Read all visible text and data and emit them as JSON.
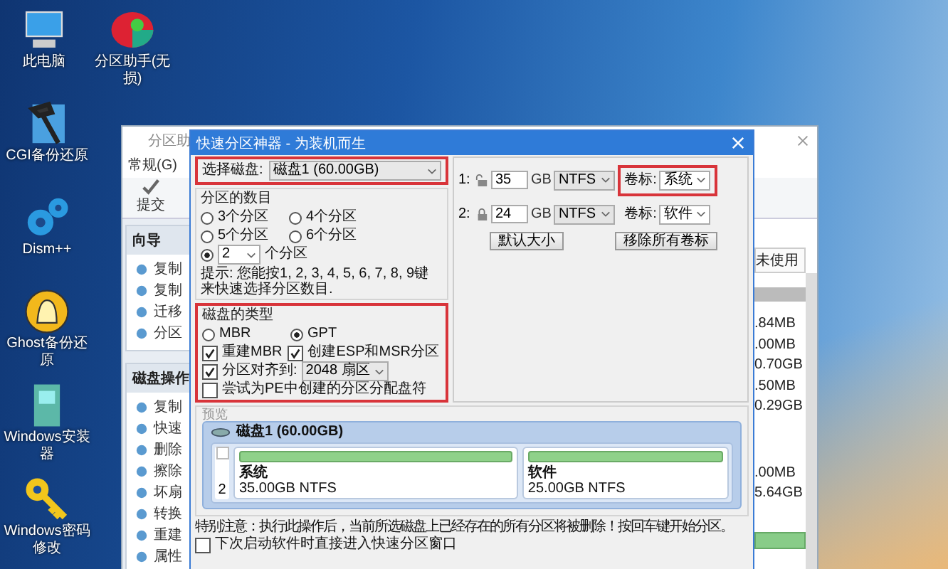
{
  "desktop_icons": [
    {
      "label": "此电脑",
      "kind": "pc"
    },
    {
      "label": "分区助手(无损)",
      "kind": "partition"
    },
    {
      "label": "CGI备份还原",
      "kind": "hammer"
    },
    {
      "label": "Dism++",
      "kind": "gears"
    },
    {
      "label": "Ghost备份还原",
      "kind": "ghost"
    },
    {
      "label": "Windows安装器",
      "kind": "installer"
    },
    {
      "label": "Windows密码修改",
      "kind": "key"
    }
  ],
  "app_window": {
    "title": "分区助",
    "menu": [
      "常规(G)"
    ],
    "toolbar": [
      "提交"
    ],
    "sections": [
      {
        "title": "向导",
        "items": [
          "复制",
          "复制",
          "迁移",
          "分区"
        ]
      },
      {
        "title": "磁盘操作",
        "items": [
          "复制",
          "快速",
          "删除",
          "擦除",
          "坏扇",
          "转换",
          "重建",
          "属性"
        ]
      }
    ],
    "column_header": "未使用",
    "values": [
      ".84MB",
      ".00MB",
      "0.70GB",
      ".50MB",
      "0.29GB"
    ],
    "values_2": [
      ".00MB",
      "5.64GB"
    ]
  },
  "dialog": {
    "title": "快速分区神器 - 为装机而生",
    "disk_select": {
      "label": "选择磁盘:",
      "value": "磁盘1 (60.00GB)",
      "highlighted": true
    },
    "count_group": {
      "title": "分区的数目",
      "options": [
        {
          "label": "3个分区",
          "selected": false
        },
        {
          "label": "4个分区",
          "selected": false
        },
        {
          "label": "5个分区",
          "selected": false
        },
        {
          "label": "6个分区",
          "selected": false
        }
      ],
      "custom": {
        "selected": true,
        "value": "2",
        "suffix": "个分区"
      },
      "hint": "提示: 您能按1, 2, 3, 4, 5, 6, 7, 8, 9键来快速选择分区数目."
    },
    "type_group": {
      "title": "磁盘的类型",
      "highlighted": true,
      "types": [
        {
          "label": "MBR",
          "selected": false
        },
        {
          "label": "GPT",
          "selected": true
        }
      ],
      "options": [
        {
          "label": "重建MBR",
          "checked": true
        },
        {
          "label": "创建ESP和MSR分区",
          "checked": true
        },
        {
          "label": "分区对齐到:",
          "checked": true,
          "value": "2048 扇区"
        },
        {
          "label": "尝试为PE中创建的分区分配盘符",
          "checked": false
        }
      ]
    },
    "partitions": [
      {
        "index": "1:",
        "locked": false,
        "size": "35",
        "unit": "GB",
        "fs": "NTFS",
        "volume_label": "卷标:",
        "volume": "系统",
        "highlighted": true
      },
      {
        "index": "2:",
        "locked": true,
        "size": "24",
        "unit": "GB",
        "fs": "NTFS",
        "volume_label": "卷标:",
        "volume": "软件",
        "highlighted": false
      }
    ],
    "buttons": [
      "默认大小",
      "移除所有卷标"
    ],
    "preview": {
      "title": "预览",
      "disk": "磁盘1 (60.00GB)",
      "disk_number": "2",
      "checked": false,
      "partitions": [
        {
          "name": "系统",
          "detail": "35.00GB NTFS"
        },
        {
          "name": "软件",
          "detail": "25.00GB NTFS"
        }
      ]
    },
    "warning": "特别注意：执行此操作后，当前所选磁盘上已经存在的所有分区将被删除！按回车键开始分区。",
    "auto_open": {
      "label": "下次启动软件时直接进入快速分区窗口",
      "checked": false
    }
  }
}
